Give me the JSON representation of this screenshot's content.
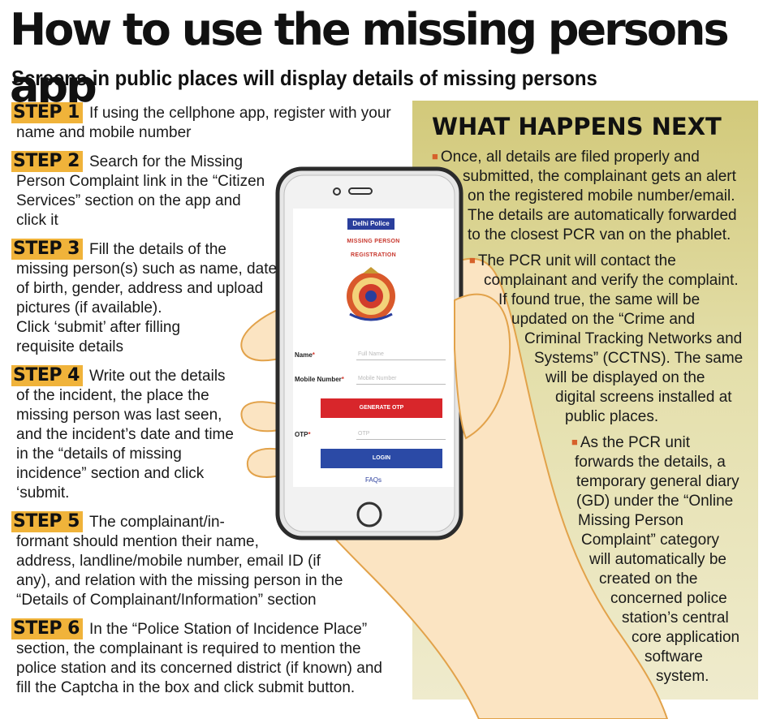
{
  "header": {
    "title": "How to use the missing persons app",
    "subtitle": "Screens in public places will display details of missing persons"
  },
  "steps": [
    {
      "badge": "STEP 1",
      "lines": [
        "If using the cellphone app, register with your",
        "name and mobile number"
      ]
    },
    {
      "badge": "STEP 2",
      "lines": [
        "Search for the Missing",
        "Person Complaint link in the “Citizen",
        "Services” section on the app and",
        "click it"
      ]
    },
    {
      "badge": "STEP 3",
      "lines": [
        "Fill the details of the",
        "missing person(s) such as name, date",
        "of birth, gender, address and upload",
        "pictures (if available).",
        "Click ‘submit’ after filling",
        "requisite details"
      ]
    },
    {
      "badge": "STEP 4",
      "lines": [
        "Write out the details",
        "of the incident, the place the",
        "missing person was last seen,",
        "and the incident’s date and time",
        "in the “details of missing",
        "incidence” section and click",
        "‘submit."
      ]
    },
    {
      "badge": "STEP 5",
      "lines": [
        "The complainant/in-",
        "formant should mention their name,",
        "address, landline/mobile number, email ID (if",
        "any), and relation with the missing person in the",
        "“Details of Complainant/Information” section"
      ]
    },
    {
      "badge": "STEP 6",
      "lines": [
        "In the “Police Station of Incidence Place”",
        "section, the complainant is required to mention the",
        "police station and its concerned district (if known) and",
        "fill the Captcha in the box and click submit button."
      ]
    }
  ],
  "next": {
    "title": "WHAT HAPPENS NEXT",
    "points": [
      {
        "lines": [
          "Once, all details are filed properly and",
          "submitted, the complainant gets an alert",
          "on the registered mobile number/email.",
          "The details are automatically forwarded",
          "to the closest PCR van on the phablet."
        ]
      },
      {
        "lines": [
          "The PCR unit will contact the",
          "complainant and verify the complaint.",
          "If found true, the same will be",
          "updated on the “Crime and",
          "Criminal Tracking Networks and",
          "Systems” (CCTNS). The same",
          "will be displayed on the",
          "digital screens installed at",
          "public places."
        ]
      },
      {
        "lines": [
          "As the PCR unit",
          "forwards the details, a",
          "temporary general diary",
          "(GD) under the “Online",
          "Missing Person",
          "Complaint” category",
          "will automatically be",
          "created on the",
          "concerned police",
          "station’s central",
          "core application",
          "software",
          "system."
        ]
      }
    ]
  },
  "phone": {
    "badge": "Delhi Police",
    "heading1": "MISSING PERSON",
    "heading2": "REGISTRATION",
    "name_label": "Name",
    "name_placeholder": "Full Name",
    "mobile_label": "Mobile Number",
    "mobile_placeholder": "Mobile Number",
    "generate_otp": "GENERATE OTP",
    "otp_label": "OTP",
    "otp_placeholder": "OTP",
    "login": "LOGIN",
    "faqs": "FAQs"
  },
  "colors": {
    "step_badge": "#f0b33a",
    "panel_top": "#d2c97a",
    "panel_bottom": "#efebcd",
    "bullet": "#d6612b",
    "hand_fill": "#fbe4c2",
    "hand_stroke": "#e2a24a",
    "generate_button": "#d8262b",
    "login_button": "#2b4aa6"
  }
}
